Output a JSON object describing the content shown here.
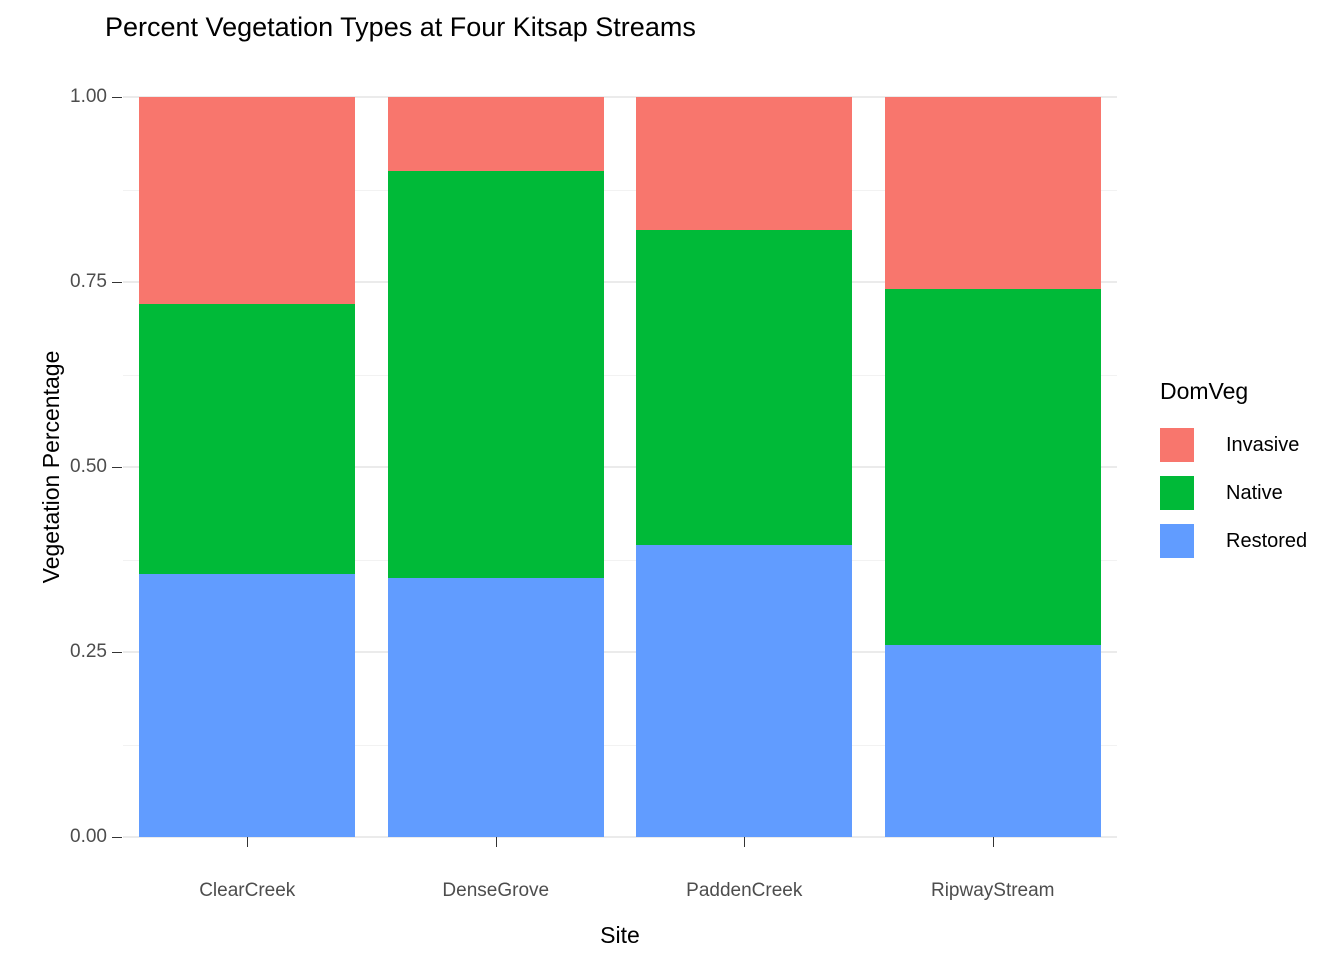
{
  "chart_data": {
    "type": "bar",
    "stacked": true,
    "stack_mode": "fill",
    "title": "Percent Vegetation Types at Four Kitsap Streams",
    "xlabel": "Site",
    "ylabel": "Vegetation Percentage",
    "categories": [
      "ClearCreek",
      "DenseGrove",
      "PaddenCreek",
      "RipwayStream"
    ],
    "ylim": [
      0,
      1
    ],
    "y_ticks": [
      0.0,
      0.25,
      0.5,
      0.75,
      1.0
    ],
    "y_tick_labels": [
      "0.00",
      "0.25",
      "0.50",
      "0.75",
      "1.00"
    ],
    "y_minor_ticks": [
      0.125,
      0.375,
      0.625,
      0.875
    ],
    "grid": true,
    "legend_title": "DomVeg",
    "legend_position": "right",
    "series": [
      {
        "name": "Invasive",
        "color": "#F8766D",
        "values": [
          0.28,
          0.1,
          0.18,
          0.26
        ]
      },
      {
        "name": "Native",
        "color": "#00BA38",
        "values": [
          0.365,
          0.55,
          0.425,
          0.48
        ]
      },
      {
        "name": "Restored",
        "color": "#619CFF",
        "values": [
          0.355,
          0.35,
          0.395,
          0.26
        ]
      }
    ],
    "stack_tops": {
      "Restored": [
        0.355,
        0.35,
        0.395,
        0.26
      ],
      "Native": [
        0.72,
        0.9,
        0.82,
        0.74
      ],
      "Invasive": [
        1.0,
        1.0,
        1.0,
        1.0
      ]
    }
  },
  "theme": {
    "panel_background": "#FFFFFF",
    "grid_major_color": "#EBEBEB",
    "grid_minor_color": "#F2F2F2",
    "axis_text_color": "#4D4D4D",
    "title_color": "#000000"
  }
}
